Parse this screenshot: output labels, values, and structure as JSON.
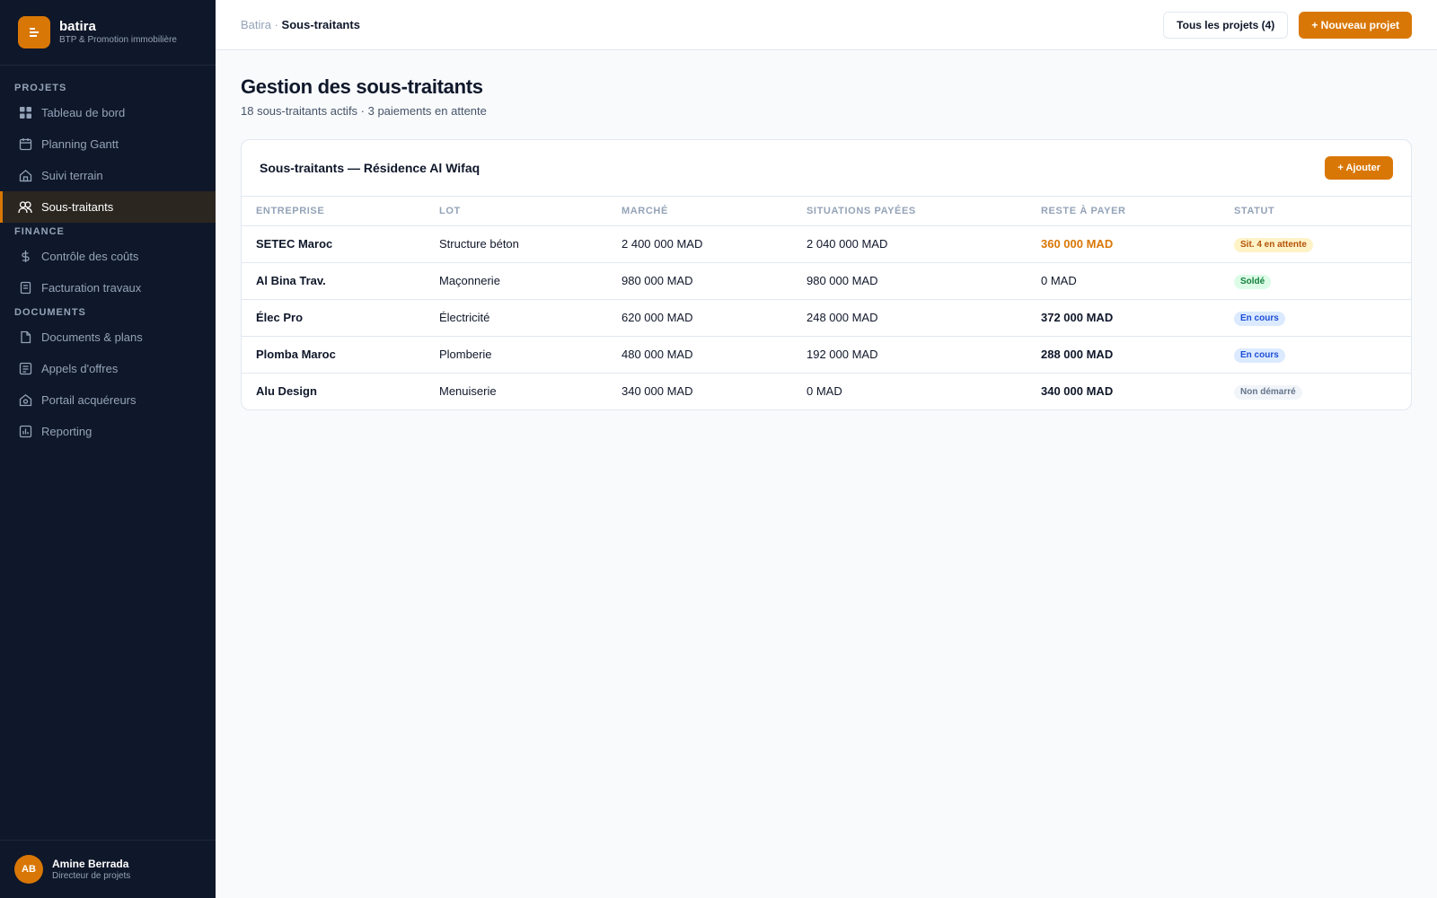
{
  "brand": {
    "name": "batira",
    "subtitle": "BTP & Promotion immobilière"
  },
  "sidebar": {
    "sections": [
      {
        "label": "PROJETS",
        "items": [
          {
            "label": "Tableau de bord",
            "icon": "grid-icon"
          },
          {
            "label": "Planning Gantt",
            "icon": "calendar-icon"
          },
          {
            "label": "Suivi terrain",
            "icon": "home-icon"
          },
          {
            "label": "Sous-traitants",
            "icon": "users-icon",
            "active": true
          }
        ]
      },
      {
        "label": "FINANCE",
        "items": [
          {
            "label": "Contrôle des coûts",
            "icon": "dollar-icon"
          },
          {
            "label": "Facturation travaux",
            "icon": "invoice-icon"
          }
        ]
      },
      {
        "label": "DOCUMENTS",
        "items": [
          {
            "label": "Documents & plans",
            "icon": "file-icon"
          },
          {
            "label": "Appels d'offres",
            "icon": "doc-list-icon"
          },
          {
            "label": "Portail acquéreurs",
            "icon": "house-key-icon"
          },
          {
            "label": "Reporting",
            "icon": "chart-icon"
          }
        ]
      }
    ]
  },
  "user": {
    "initials": "AB",
    "name": "Amine Berrada",
    "role": "Directeur de projets"
  },
  "topbar": {
    "breadcrumb_root": "Batira",
    "breadcrumb_sep": " · ",
    "breadcrumb_current": "Sous-traitants",
    "all_projects_label": "Tous les projets (4)",
    "new_project_label": "+ Nouveau projet"
  },
  "page": {
    "title": "Gestion des sous-traitants",
    "subtitle": "18 sous-traitants actifs · 3 paiements en attente"
  },
  "card": {
    "title": "Sous-traitants — Résidence Al Wifaq",
    "add_label": "+ Ajouter",
    "columns": [
      "ENTREPRISE",
      "LOT",
      "MARCHÉ",
      "SITUATIONS PAYÉES",
      "RESTE À PAYER",
      "STATUT"
    ],
    "rows": [
      {
        "company": "SETEC Maroc",
        "lot": "Structure béton",
        "market": "2 400 000 MAD",
        "paid": "2 040 000 MAD",
        "remaining": "360 000 MAD",
        "remaining_style": "accent",
        "status": "Sit. 4 en attente",
        "status_type": "warn"
      },
      {
        "company": "Al Bina Trav.",
        "lot": "Maçonnerie",
        "market": "980 000 MAD",
        "paid": "980 000 MAD",
        "remaining": "0 MAD",
        "remaining_style": "normal",
        "status": "Soldé",
        "status_type": "ok"
      },
      {
        "company": "Élec Pro",
        "lot": "Électricité",
        "market": "620 000 MAD",
        "paid": "248 000 MAD",
        "remaining": "372 000 MAD",
        "remaining_style": "bold",
        "status": "En cours",
        "status_type": "info"
      },
      {
        "company": "Plomba Maroc",
        "lot": "Plomberie",
        "market": "480 000 MAD",
        "paid": "192 000 MAD",
        "remaining": "288 000 MAD",
        "remaining_style": "bold",
        "status": "En cours",
        "status_type": "info"
      },
      {
        "company": "Alu Design",
        "lot": "Menuiserie",
        "market": "340 000 MAD",
        "paid": "0 MAD",
        "remaining": "340 000 MAD",
        "remaining_style": "bold",
        "status": "Non démarré",
        "status_type": "idle"
      }
    ]
  },
  "colors": {
    "accent": "#d97706",
    "sidebar_bg": "#0f172a",
    "page_bg": "#f8fafc"
  }
}
